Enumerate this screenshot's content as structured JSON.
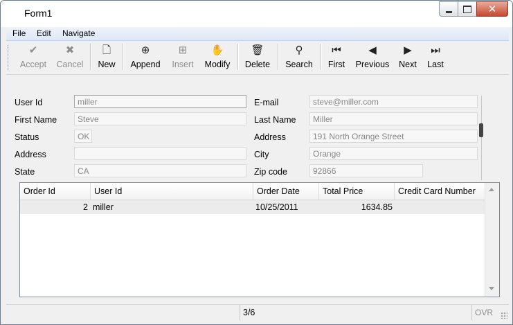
{
  "window": {
    "title": "Form1"
  },
  "caption": {
    "close_glyph": "✕"
  },
  "menu": {
    "items": [
      "File",
      "Edit",
      "Navigate"
    ]
  },
  "toolbar": {
    "buttons": [
      {
        "label": "Accept",
        "icon": "checkmark-icon",
        "glyph": "✔",
        "enabled": false
      },
      {
        "label": "Cancel",
        "icon": "x-icon",
        "glyph": "✖",
        "enabled": false
      },
      {
        "label": "New",
        "icon": "new-document-icon",
        "glyph": "🗋",
        "enabled": true
      },
      {
        "label": "Append",
        "icon": "append-record-icon",
        "glyph": "⊕",
        "enabled": true
      },
      {
        "label": "Insert",
        "icon": "insert-record-icon",
        "glyph": "⊞",
        "enabled": false
      },
      {
        "label": "Modify",
        "icon": "hand-pointer-icon",
        "glyph": "✋",
        "enabled": true
      },
      {
        "label": "Delete",
        "icon": "trash-icon",
        "glyph": "🗑",
        "enabled": true
      },
      {
        "label": "Search",
        "icon": "binoculars-icon",
        "glyph": "⚲",
        "enabled": true
      },
      {
        "label": "First",
        "icon": "first-record-icon",
        "glyph": "⏮",
        "enabled": true
      },
      {
        "label": "Previous",
        "icon": "previous-record-icon",
        "glyph": "◀",
        "enabled": true
      },
      {
        "label": "Next",
        "icon": "next-record-icon",
        "glyph": "▶",
        "enabled": true
      },
      {
        "label": "Last",
        "icon": "last-record-icon",
        "glyph": "⏭",
        "enabled": true
      }
    ]
  },
  "form": {
    "user_id": {
      "label": "User Id",
      "value": "miller"
    },
    "first_name": {
      "label": "First Name",
      "value": "Steve"
    },
    "status": {
      "label": "Status",
      "value": "OK"
    },
    "address_left": {
      "label": "Address",
      "value": ""
    },
    "state": {
      "label": "State",
      "value": "CA"
    },
    "email": {
      "label": "E-mail",
      "value": "steve@miller.com"
    },
    "last_name": {
      "label": "Last Name",
      "value": "Miller"
    },
    "address_right": {
      "label": "Address",
      "value": "191 North Orange Street"
    },
    "city": {
      "label": "City",
      "value": "Orange"
    },
    "zip": {
      "label": "Zip code",
      "value": "92866"
    }
  },
  "grid": {
    "columns": [
      "Order Id",
      "User Id",
      "Order Date",
      "Total Price",
      "Credit Card Number"
    ],
    "rows": [
      {
        "order_id": "2",
        "user_id": "miller",
        "order_date": "10/25/2011",
        "total_price": "1634.85",
        "credit_card": ""
      }
    ]
  },
  "status": {
    "position": "3/6",
    "mode": "OVR"
  },
  "colors": {
    "accent_menu": "#dde8f7",
    "close_button": "#c8482d",
    "disabled_text": "#8c8c8c"
  }
}
